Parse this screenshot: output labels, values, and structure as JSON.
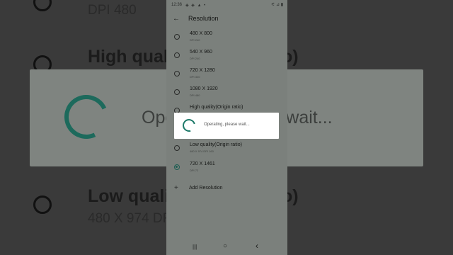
{
  "background": {
    "sub_top": "DPI 480",
    "high_quality_partial": "High quality",
    "ratio_partial": "o)",
    "operating_partial": "Operating, please wait...",
    "low_quality_partial": "Low quali",
    "low_paren_partial": "o)",
    "low_sub_partial": "480 X 974 DF"
  },
  "status_bar": {
    "time": "12:36",
    "icons": "◈ ◈ ▲ •",
    "right": "⚟ ⊿ ▮"
  },
  "toolbar": {
    "back_icon": "back-arrow-icon",
    "title": "Resolution"
  },
  "options": [
    {
      "label": "480 X 800",
      "sub": "DPI 240",
      "selected": false
    },
    {
      "label": "540 X 960",
      "sub": "DPI 240",
      "selected": false
    },
    {
      "label": "720 X 1280",
      "sub": "DPI 320",
      "selected": false
    },
    {
      "label": "1080 X 1920",
      "sub": "DPI 480",
      "selected": false
    },
    {
      "label": "High quality(Origin ratio)",
      "sub": "",
      "selected": false
    },
    {
      "label": "Low quality(Origin ratio)",
      "sub": "480 X 974 DPI 160",
      "selected": false
    },
    {
      "label": "720 X 1461",
      "sub": "DPI 72",
      "selected": true
    }
  ],
  "add_resolution": {
    "icon": "plus-icon",
    "label": "Add Resolution"
  },
  "dialog": {
    "message": "Operating, please wait..."
  },
  "nav": {
    "recents": "|||",
    "home": "○",
    "back": "‹"
  },
  "colors": {
    "accent": "#1e7a6a",
    "overlay": "#7b807c"
  }
}
